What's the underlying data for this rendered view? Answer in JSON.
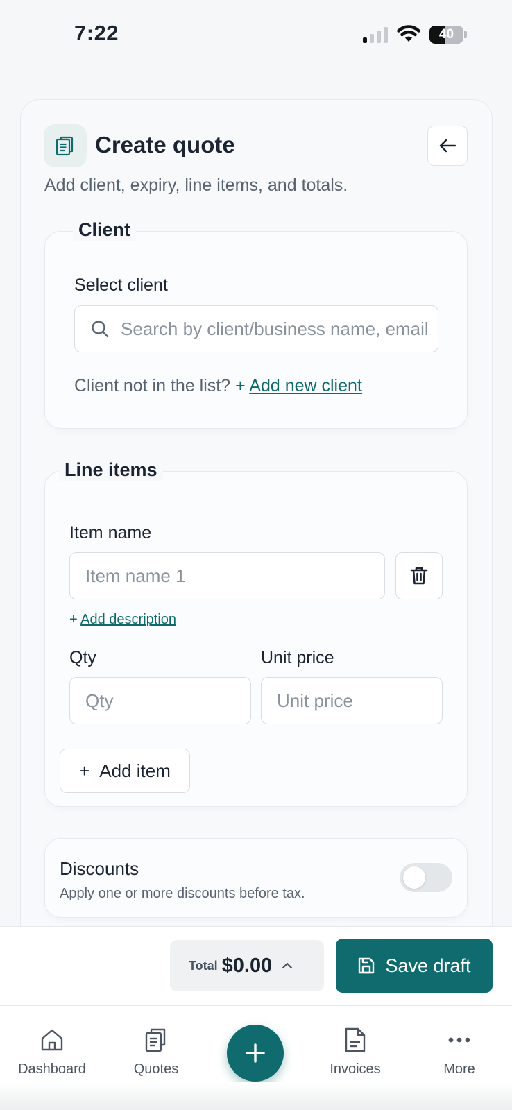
{
  "status": {
    "time": "7:22",
    "battery": "40"
  },
  "header": {
    "title": "Create quote",
    "subtitle": "Add client, expiry, line items, and totals."
  },
  "client": {
    "legend": "Client",
    "select_label": "Select client",
    "search_placeholder": "Search by client/business name, email",
    "not_in_list": "Client not in the list?",
    "add_prefix": "+",
    "add_link": "Add new client"
  },
  "line_items": {
    "legend": "Line items",
    "item_name_label": "Item name",
    "item_name_placeholder": "Item name 1",
    "add_desc_prefix": "+",
    "add_description": "Add description",
    "qty_label": "Qty",
    "qty_placeholder": "Qty",
    "unit_price_label": "Unit price",
    "unit_price_placeholder": "Unit price",
    "add_item_prefix": "+",
    "add_item": "Add item"
  },
  "discounts": {
    "title": "Discounts",
    "description": "Apply one or more discounts before tax.",
    "enabled": false
  },
  "footer": {
    "total_label": "Total",
    "total_value": "$0.00",
    "save_label": "Save draft"
  },
  "nav": {
    "dashboard": "Dashboard",
    "quotes": "Quotes",
    "invoices": "Invoices",
    "more": "More"
  },
  "colors": {
    "accent": "#0f6b6d",
    "text": "#1b2430",
    "muted": "#5a6470"
  }
}
